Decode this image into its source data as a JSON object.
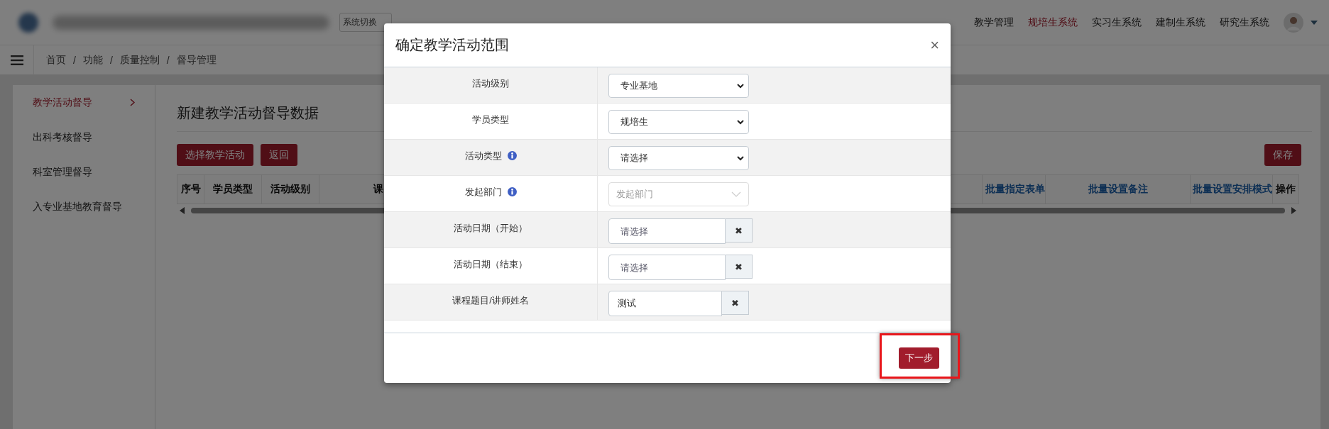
{
  "header": {
    "system_switch": "系统切换",
    "nav": [
      {
        "label": "教学管理",
        "selected": false
      },
      {
        "label": "规培生系统",
        "selected": true
      },
      {
        "label": "实习生系统",
        "selected": false
      },
      {
        "label": "建制生系统",
        "selected": false
      },
      {
        "label": "研究生系统",
        "selected": false
      }
    ]
  },
  "breadcrumb": {
    "separator": "/",
    "items": [
      "首页",
      "功能",
      "质量控制",
      "督导管理"
    ]
  },
  "sidebar": {
    "items": [
      {
        "label": "教学活动督导",
        "selected": true
      },
      {
        "label": "出科考核督导",
        "selected": false
      },
      {
        "label": "科室管理督导",
        "selected": false
      },
      {
        "label": "入专业基地教育督导",
        "selected": false
      }
    ]
  },
  "main": {
    "title": "新建教学活动督导数据",
    "buttons": [
      "选择教学活动",
      "返回"
    ],
    "save_button": "保存",
    "table": {
      "columns": [
        {
          "label": "序号",
          "kind": "plain"
        },
        {
          "label": "学员类型",
          "kind": "plain"
        },
        {
          "label": "活动级别",
          "kind": "plain"
        },
        {
          "label": "课",
          "kind": "plain"
        },
        {
          "label": "批量指定表单",
          "kind": "link"
        },
        {
          "label": "批量设置备注",
          "kind": "link"
        },
        {
          "label": "批量设置安排模式",
          "kind": "link"
        },
        {
          "label": "操作",
          "kind": "plain"
        }
      ]
    }
  },
  "modal": {
    "title": "确定教学活动范围",
    "close": "×",
    "rows": [
      {
        "label": "活动级别",
        "info": false,
        "kind": "select",
        "value": "专业基地"
      },
      {
        "label": "学员类型",
        "info": false,
        "kind": "select",
        "value": "规培生"
      },
      {
        "label": "活动类型",
        "info": true,
        "kind": "select",
        "value": "请选择"
      },
      {
        "label": "发起部门",
        "info": true,
        "kind": "picker",
        "placeholder": "发起部门"
      },
      {
        "label": "活动日期（开始）",
        "info": false,
        "kind": "clearable",
        "placeholder": "请选择",
        "clear": "✖"
      },
      {
        "label": "活动日期（结束）",
        "info": false,
        "kind": "clearable",
        "placeholder": "请选择",
        "clear": "✖"
      },
      {
        "label": "课程题目/讲师姓名",
        "info": false,
        "kind": "clearable",
        "value": "测试",
        "clear": "✖"
      }
    ],
    "next_button": {
      "label": "下一步",
      "highlighted": true
    }
  }
}
